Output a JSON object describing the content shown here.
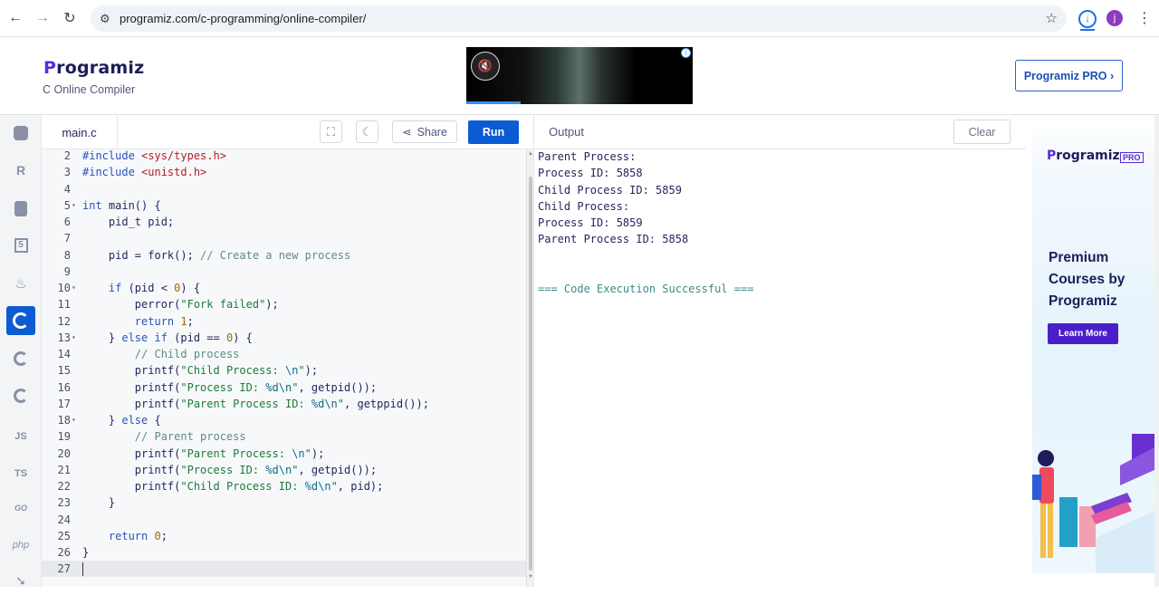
{
  "browser": {
    "url": "programiz.com/c-programming/online-compiler/",
    "avatar_letter": "j"
  },
  "site": {
    "logo_text": "Programiz",
    "subtitle": "C Online Compiler",
    "pro_button": "Programiz PRO ›"
  },
  "editor": {
    "filename": "main.c",
    "share_label": "Share",
    "run_label": "Run",
    "lines": [
      {
        "n": "2",
        "fold": "",
        "html": "<span class=\"k-pre\">#include</span> <span class=\"k-str\">&lt;sys/types.h&gt;</span>"
      },
      {
        "n": "3",
        "fold": "",
        "html": "<span class=\"k-pre\">#include</span> <span class=\"k-str\">&lt;unistd.h&gt;</span>"
      },
      {
        "n": "4",
        "fold": "",
        "html": ""
      },
      {
        "n": "5",
        "fold": "▾",
        "html": "<span class=\"k-kw\">int</span> main() {"
      },
      {
        "n": "6",
        "fold": "",
        "html": "    pid_t pid;"
      },
      {
        "n": "7",
        "fold": "",
        "html": ""
      },
      {
        "n": "8",
        "fold": "",
        "html": "    pid = fork(); <span class=\"k-cm\">// Create a new process</span>"
      },
      {
        "n": "9",
        "fold": "",
        "html": ""
      },
      {
        "n": "10",
        "fold": "▾",
        "html": "    <span class=\"k-kw\">if</span> (pid &lt; <span class=\"k-num\">0</span>) {"
      },
      {
        "n": "11",
        "fold": "",
        "html": "        perror(<span class=\"k-s2\">\"Fork failed\"</span>);"
      },
      {
        "n": "12",
        "fold": "",
        "html": "        <span class=\"k-kw\">return</span> <span class=\"k-num\">1</span>;"
      },
      {
        "n": "13",
        "fold": "▾",
        "html": "    } <span class=\"k-kw\">else if</span> (pid == <span class=\"k-num\">0</span>) {"
      },
      {
        "n": "14",
        "fold": "",
        "html": "        <span class=\"k-cm\">// Child process</span>"
      },
      {
        "n": "15",
        "fold": "",
        "html": "        printf(<span class=\"k-s2\">\"Child Process: <span class=\"k-fmt\">\\n</span>\"</span>);"
      },
      {
        "n": "16",
        "fold": "",
        "html": "        printf(<span class=\"k-s2\">\"Process ID: <span class=\"k-fmt\">%d\\n</span>\"</span>, getpid());"
      },
      {
        "n": "17",
        "fold": "",
        "html": "        printf(<span class=\"k-s2\">\"Parent Process ID: <span class=\"k-fmt\">%d\\n</span>\"</span>, getppid());"
      },
      {
        "n": "18",
        "fold": "▾",
        "html": "    } <span class=\"k-kw\">else</span> {"
      },
      {
        "n": "19",
        "fold": "",
        "html": "        <span class=\"k-cm\">// Parent process</span>"
      },
      {
        "n": "20",
        "fold": "",
        "html": "        printf(<span class=\"k-s2\">\"Parent Process: <span class=\"k-fmt\">\\n</span>\"</span>);"
      },
      {
        "n": "21",
        "fold": "",
        "html": "        printf(<span class=\"k-s2\">\"Process ID: <span class=\"k-fmt\">%d\\n</span>\"</span>, getpid());"
      },
      {
        "n": "22",
        "fold": "",
        "html": "        printf(<span class=\"k-s2\">\"Child Process ID: <span class=\"k-fmt\">%d\\n</span>\"</span>, pid);"
      },
      {
        "n": "23",
        "fold": "",
        "html": "    }"
      },
      {
        "n": "24",
        "fold": "",
        "html": ""
      },
      {
        "n": "25",
        "fold": "",
        "html": "    <span class=\"k-kw\">return</span> <span class=\"k-num\">0</span>;"
      },
      {
        "n": "26",
        "fold": "",
        "html": "}"
      },
      {
        "n": "27",
        "fold": "",
        "html": ""
      }
    ]
  },
  "output": {
    "title": "Output",
    "clear_label": "Clear",
    "lines": [
      "Parent Process:",
      "Process ID: 5858",
      "Child Process ID: 5859",
      "Child Process:",
      "Process ID: 5859",
      "Parent Process ID: 5858",
      "",
      "",
      "=== Code Execution Successful ==="
    ]
  },
  "languages": [
    {
      "name": "python",
      "label": ""
    },
    {
      "name": "r",
      "label": "R"
    },
    {
      "name": "sql",
      "label": ""
    },
    {
      "name": "html",
      "label": "5"
    },
    {
      "name": "java",
      "label": "♨"
    },
    {
      "name": "c",
      "label": "C",
      "active": true
    },
    {
      "name": "cpp",
      "label": "C"
    },
    {
      "name": "csharp",
      "label": "C"
    },
    {
      "name": "js",
      "label": "JS"
    },
    {
      "name": "ts",
      "label": "TS"
    },
    {
      "name": "go",
      "label": "GO"
    },
    {
      "name": "php",
      "label": "php"
    },
    {
      "name": "swift",
      "label": "➘"
    }
  ],
  "side_ad": {
    "logo": "Programiz",
    "pro": "PRO",
    "headline": "Premium Courses by Programiz",
    "cta": "Learn More"
  },
  "colors": {
    "accent": "#0b5bd3",
    "brand_purple": "#5a2bd8"
  }
}
